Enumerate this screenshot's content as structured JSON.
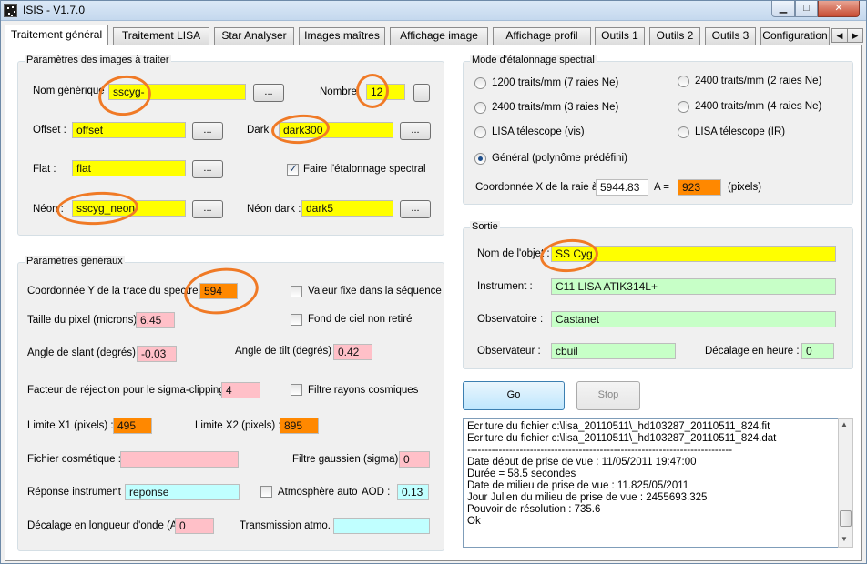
{
  "window": {
    "title": "ISIS - V1.7.0"
  },
  "tabs": [
    {
      "label": "Traitement général"
    },
    {
      "label": "Traitement LISA"
    },
    {
      "label": "Star Analyser"
    },
    {
      "label": "Images maîtres"
    },
    {
      "label": "Affichage image"
    },
    {
      "label": "Affichage profil"
    },
    {
      "label": "Outils 1"
    },
    {
      "label": "Outils 2"
    },
    {
      "label": "Outils 3"
    },
    {
      "label": "Configuration"
    }
  ],
  "images": {
    "title": "Paramètres des images à traiter",
    "generic_label": "Nom générique",
    "generic_value": "sscyg-",
    "count_label": "Nombre",
    "count_value": "12",
    "offset_label": "Offset :",
    "offset_value": "offset",
    "dark_label": "Dark :",
    "dark_value": "dark300",
    "flat_label": "Flat :",
    "flat_value": "flat",
    "spectral_cal_label": "Faire l'étalonnage spectral",
    "neon_label": "Néon :",
    "neon_value": "sscyg_neon",
    "neon_dark_label": "Néon dark :",
    "neon_dark_value": "dark5",
    "browse": "..."
  },
  "general": {
    "title": "Paramètres généraux",
    "y_label": "Coordonnée Y de la trace du spectre :",
    "y_value": "594",
    "fixed_label": "Valeur fixe dans la séquence",
    "pixel_label": "Taille du pixel (microns) :",
    "pixel_value": "6.45",
    "sky_label": "Fond de ciel non retiré",
    "slant_label": "Angle de slant (degrés) :",
    "slant_value": "-0.03",
    "tilt_label": "Angle de tilt (degrés) :",
    "tilt_value": "0.42",
    "sigma_label": "Facteur de réjection pour le sigma-clipping :",
    "sigma_value": "4",
    "cosmic_label": "Filtre rayons cosmiques",
    "x1_label": "Limite X1 (pixels) :",
    "x1_value": "495",
    "x2_label": "Limite X2 (pixels) :",
    "x2_value": "895",
    "cosmetic_label": "Fichier cosmétique :",
    "cosmetic_value": "",
    "gauss_label": "Filtre gaussien (sigma) :",
    "gauss_value": "0",
    "response_label": "Réponse instrument :",
    "response_value": "reponse",
    "atmo_label": "Atmosphère auto",
    "aod_label": "AOD :",
    "aod_value": "0.13",
    "shift_label": "Décalage en longueur d'onde (A) :",
    "shift_value": "0",
    "transmission_label": "Transmission atmo. :",
    "transmission_value": ""
  },
  "calibration": {
    "title": "Mode d'étalonnage spectral",
    "opt1": "1200 traits/mm (7 raies Ne)",
    "opt2": "2400 traits/mm (2 raies Ne)",
    "opt3": "2400 traits/mm (3 raies Ne)",
    "opt4": "2400 traits/mm (4 raies Ne)",
    "opt5": "LISA télescope (vis)",
    "opt6": "LISA télescope (IR)",
    "opt7": "Général (polynôme prédéfini)",
    "coord_label": "Coordonnée X de la raie à",
    "coord_value": "5944.83",
    "a_label": "A =",
    "a_value": "923",
    "pixels_label": "(pixels)"
  },
  "output": {
    "title": "Sortie",
    "object_label": "Nom de l'objet :",
    "object_value": "SS Cyg",
    "instrument_label": "Instrument :",
    "instrument_value": "C11 LISA ATIK314L+",
    "observatory_label": "Observatoire :",
    "observatory_value": "Castanet",
    "observer_label": "Observateur :",
    "observer_value": "cbuil",
    "hour_label": "Décalage en heure :",
    "hour_value": "0"
  },
  "actions": {
    "go": "Go",
    "stop": "Stop"
  },
  "log": [
    "Ecriture du fichier c:\\lisa_20110511\\_hd103287_20110511_824.fit",
    "Ecriture du fichier c:\\lisa_20110511\\_hd103287_20110511_824.dat",
    "----------------------------------------------------------------------------",
    "Date début de prise de vue : 11/05/2011 19:47:00",
    "Durée = 58.5 secondes",
    "Date de milieu de prise de vue : 11.825/05/2011",
    "Jour Julien du milieu de prise de vue : 2455693.325",
    "Pouvoir de résolution : 735.6",
    "Ok"
  ],
  "colors": {
    "required": "#ffff00",
    "numeric": "#ffc0c8",
    "measured": "#ff8800",
    "meta": "#c7ffc7",
    "optional": "#c0ffff",
    "annotation": "#f07a26"
  }
}
